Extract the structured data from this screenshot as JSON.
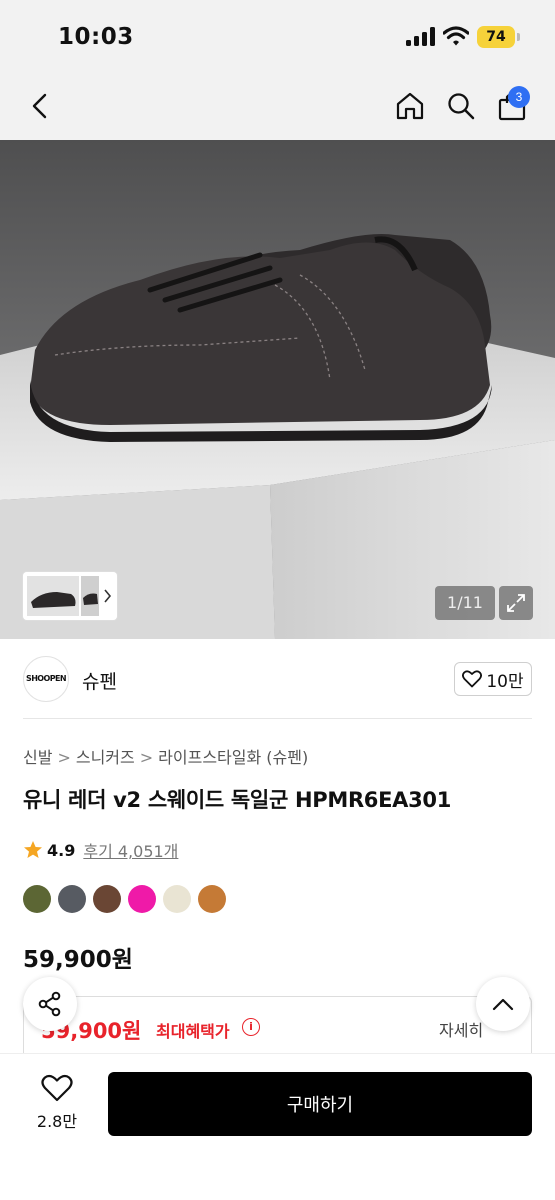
{
  "status_bar": {
    "time": "10:03",
    "battery": "74"
  },
  "header": {
    "cart_count": "3"
  },
  "gallery": {
    "counter": "1/11"
  },
  "brand": {
    "logo_text": "SHOOPEN",
    "name": "슈펜",
    "likes": "10만"
  },
  "breadcrumb": [
    "신발",
    "스니커즈",
    "라이프스타일화 (슈펜)"
  ],
  "product": {
    "title": "유니 레더 v2 스웨이드 독일군 HPMR6EA301",
    "rating": "4.9",
    "reviews": "후기 4,051개",
    "price": "59,900원",
    "colors": [
      "#5c6634",
      "#575b62",
      "#6a4634",
      "#ef1aa8",
      "#e9e4d3",
      "#c57a36"
    ]
  },
  "benefit": {
    "price": "59,900원",
    "label": "최대혜택가",
    "info": "i",
    "detail": "자세히"
  },
  "bottom": {
    "wish_count": "2.8만",
    "buy_label": "구매하기"
  },
  "colors": {
    "accent_red": "#e8232b",
    "badge_blue": "#2f6ff3",
    "battery_yellow": "#f6d23a"
  }
}
